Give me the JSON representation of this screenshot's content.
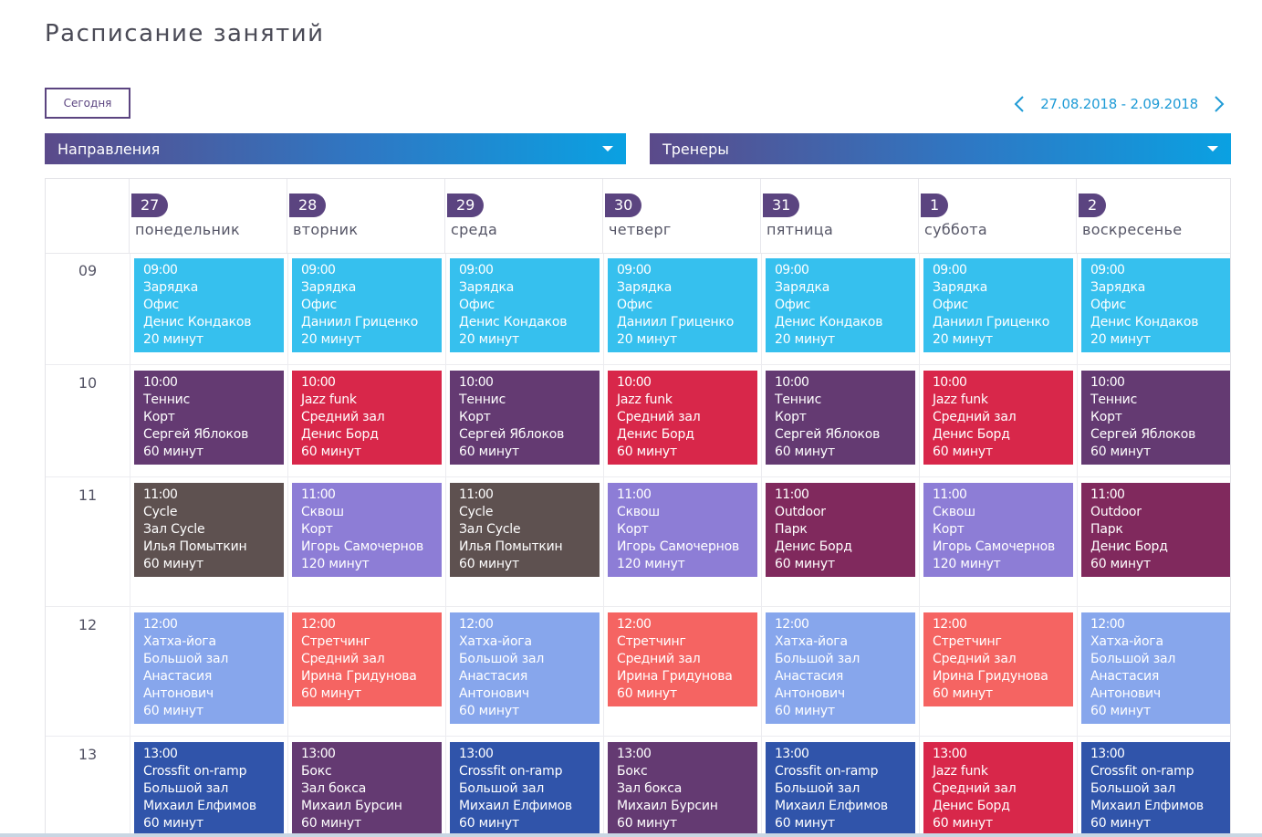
{
  "page": {
    "title": "Расписание занятий"
  },
  "toolbar": {
    "today_label": "Сегодня",
    "week_range": "27.08.2018 - 2.09.2018"
  },
  "filters": {
    "directions_label": "Направления",
    "trainers_label": "Тренеры"
  },
  "days": [
    {
      "num": "27",
      "name": "понедельник"
    },
    {
      "num": "28",
      "name": "вторник"
    },
    {
      "num": "29",
      "name": "среда"
    },
    {
      "num": "30",
      "name": "четверг"
    },
    {
      "num": "31",
      "name": "пятница"
    },
    {
      "num": "1",
      "name": "суббота"
    },
    {
      "num": "2",
      "name": "воскресенье"
    }
  ],
  "hours": [
    "09",
    "10",
    "11",
    "12",
    "13"
  ],
  "colors": {
    "morning": "#36c0ee",
    "tennis": "#643a72",
    "jazz": "#d8274a",
    "cycle": "#5e5150",
    "squash": "#8d7dd6",
    "outdoor": "#80295d",
    "hatha": "#87a6ec",
    "stretching": "#f56462",
    "crossfit": "#3054aa",
    "boxing": "#643a72"
  },
  "events": [
    [
      {
        "time": "09:00",
        "name": "Зарядка",
        "place": "Офис",
        "trainer": "Денис Кондаков",
        "duration": "20 минут",
        "color": "morning"
      },
      {
        "time": "09:00",
        "name": "Зарядка",
        "place": "Офис",
        "trainer": "Даниил Гриценко",
        "duration": "20 минут",
        "color": "morning"
      },
      {
        "time": "09:00",
        "name": "Зарядка",
        "place": "Офис",
        "trainer": "Денис Кондаков",
        "duration": "20 минут",
        "color": "morning"
      },
      {
        "time": "09:00",
        "name": "Зарядка",
        "place": "Офис",
        "trainer": "Даниил Гриценко",
        "duration": "20 минут",
        "color": "morning"
      },
      {
        "time": "09:00",
        "name": "Зарядка",
        "place": "Офис",
        "trainer": "Денис Кондаков",
        "duration": "20 минут",
        "color": "morning"
      },
      {
        "time": "09:00",
        "name": "Зарядка",
        "place": "Офис",
        "trainer": "Даниил Гриценко",
        "duration": "20 минут",
        "color": "morning"
      },
      {
        "time": "09:00",
        "name": "Зарядка",
        "place": "Офис",
        "trainer": "Денис Кондаков",
        "duration": "20 минут",
        "color": "morning"
      }
    ],
    [
      {
        "time": "10:00",
        "name": "Теннис",
        "place": "Корт",
        "trainer": "Сергей Яблоков",
        "duration": "60 минут",
        "color": "tennis"
      },
      {
        "time": "10:00",
        "name": "Jazz funk",
        "place": "Средний зал",
        "trainer": "Денис Борд",
        "duration": "60 минут",
        "color": "jazz"
      },
      {
        "time": "10:00",
        "name": "Теннис",
        "place": "Корт",
        "trainer": "Сергей Яблоков",
        "duration": "60 минут",
        "color": "tennis"
      },
      {
        "time": "10:00",
        "name": "Jazz funk",
        "place": "Средний зал",
        "trainer": "Денис Борд",
        "duration": "60 минут",
        "color": "jazz"
      },
      {
        "time": "10:00",
        "name": "Теннис",
        "place": "Корт",
        "trainer": "Сергей Яблоков",
        "duration": "60 минут",
        "color": "tennis"
      },
      {
        "time": "10:00",
        "name": "Jazz funk",
        "place": "Средний зал",
        "trainer": "Денис Борд",
        "duration": "60 минут",
        "color": "jazz"
      },
      {
        "time": "10:00",
        "name": "Теннис",
        "place": "Корт",
        "trainer": "Сергей Яблоков",
        "duration": "60 минут",
        "color": "tennis"
      }
    ],
    [
      {
        "time": "11:00",
        "name": "Cycle",
        "place": "Зал Cycle",
        "trainer": "Илья Помыткин",
        "duration": "60 минут",
        "color": "cycle"
      },
      {
        "time": "11:00",
        "name": "Сквош",
        "place": "Корт",
        "trainer": "Игорь Самочернов",
        "duration": "120 минут",
        "color": "squash"
      },
      {
        "time": "11:00",
        "name": "Cycle",
        "place": "Зал Cycle",
        "trainer": "Илья Помыткин",
        "duration": "60 минут",
        "color": "cycle"
      },
      {
        "time": "11:00",
        "name": "Сквош",
        "place": "Корт",
        "trainer": "Игорь Самочернов",
        "duration": "120 минут",
        "color": "squash"
      },
      {
        "time": "11:00",
        "name": "Outdoor",
        "place": "Парк",
        "trainer": "Денис Борд",
        "duration": "60 минут",
        "color": "outdoor"
      },
      {
        "time": "11:00",
        "name": "Сквош",
        "place": "Корт",
        "trainer": "Игорь Самочернов",
        "duration": "120 минут",
        "color": "squash"
      },
      {
        "time": "11:00",
        "name": "Outdoor",
        "place": "Парк",
        "trainer": "Денис Борд",
        "duration": "60 минут",
        "color": "outdoor"
      }
    ],
    [
      {
        "time": "12:00",
        "name": "Хатха-йога",
        "place": "Большой зал",
        "trainer": "Анастасия Антонович",
        "duration": "60 минут",
        "color": "hatha"
      },
      {
        "time": "12:00",
        "name": "Стретчинг",
        "place": "Средний зал",
        "trainer": "Ирина Гридунова",
        "duration": "60 минут",
        "color": "stretching"
      },
      {
        "time": "12:00",
        "name": "Хатха-йога",
        "place": "Большой зал",
        "trainer": "Анастасия Антонович",
        "duration": "60 минут",
        "color": "hatha"
      },
      {
        "time": "12:00",
        "name": "Стретчинг",
        "place": "Средний зал",
        "trainer": "Ирина Гридунова",
        "duration": "60 минут",
        "color": "stretching"
      },
      {
        "time": "12:00",
        "name": "Хатха-йога",
        "place": "Большой зал",
        "trainer": "Анастасия Антонович",
        "duration": "60 минут",
        "color": "hatha"
      },
      {
        "time": "12:00",
        "name": "Стретчинг",
        "place": "Средний зал",
        "trainer": "Ирина Гридунова",
        "duration": "60 минут",
        "color": "stretching"
      },
      {
        "time": "12:00",
        "name": "Хатха-йога",
        "place": "Большой зал",
        "trainer": "Анастасия Антонович",
        "duration": "60 минут",
        "color": "hatha"
      }
    ],
    [
      {
        "time": "13:00",
        "name": "Crossfit on-ramp",
        "place": "Большой зал",
        "trainer": "Михаил Елфимов",
        "duration": "60 минут",
        "color": "crossfit"
      },
      {
        "time": "13:00",
        "name": "Бокс",
        "place": "Зал бокса",
        "trainer": "Михаил Бурсин",
        "duration": "60 минут",
        "color": "boxing"
      },
      {
        "time": "13:00",
        "name": "Crossfit on-ramp",
        "place": "Большой зал",
        "trainer": "Михаил Елфимов",
        "duration": "60 минут",
        "color": "crossfit"
      },
      {
        "time": "13:00",
        "name": "Бокс",
        "place": "Зал бокса",
        "trainer": "Михаил Бурсин",
        "duration": "60 минут",
        "color": "boxing"
      },
      {
        "time": "13:00",
        "name": "Crossfit on-ramp",
        "place": "Большой зал",
        "trainer": "Михаил Елфимов",
        "duration": "60 минут",
        "color": "crossfit"
      },
      {
        "time": "13:00",
        "name": "Jazz funk",
        "place": "Средний зал",
        "trainer": "Денис Борд",
        "duration": "60 минут",
        "color": "jazz"
      },
      {
        "time": "13:00",
        "name": "Crossfit on-ramp",
        "place": "Большой зал",
        "trainer": "Михаил Елфимов",
        "duration": "60 минут",
        "color": "crossfit"
      }
    ]
  ]
}
